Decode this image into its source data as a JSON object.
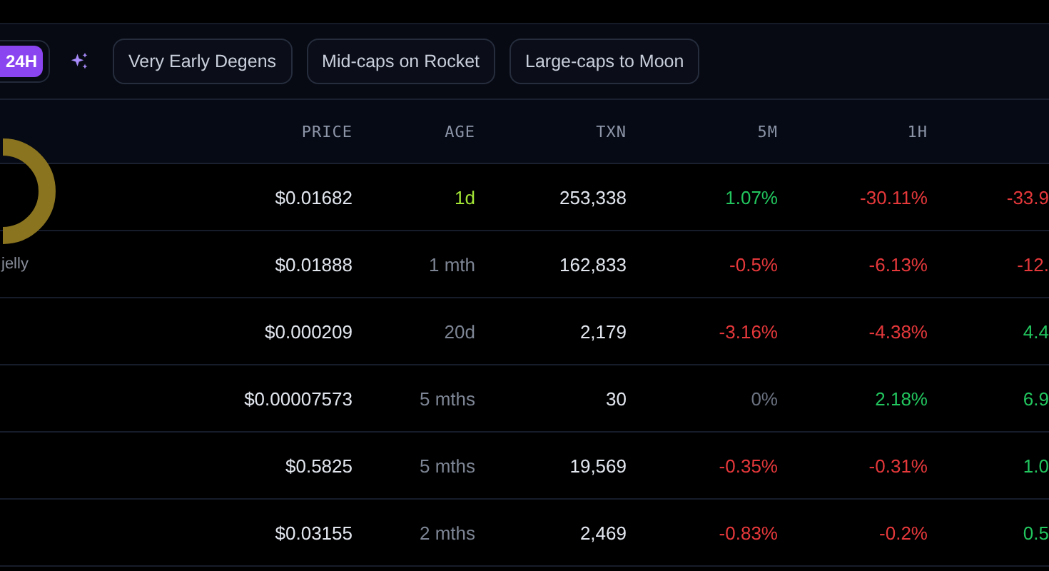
{
  "toolbar": {
    "timeframes": [
      {
        "label": "24H",
        "selected": true
      }
    ],
    "presets": [
      {
        "label": "Very Early Degens"
      },
      {
        "label": "Mid-caps on Rocket"
      },
      {
        "label": "Large-caps to Moon"
      }
    ]
  },
  "table": {
    "columns": [
      "PRICE",
      "AGE",
      "TXN",
      "5M",
      "1H"
    ],
    "rows": [
      {
        "token": "",
        "price": "$0.01682",
        "age": "1d",
        "age_new": true,
        "txn": "253,338",
        "m5": "1.07%",
        "h1": "-30.11%",
        "column_7": "-33.9"
      },
      {
        "token": "jelly",
        "price": "$0.01888",
        "age": "1 mth",
        "age_new": false,
        "txn": "162,833",
        "m5": "-0.5%",
        "h1": "-6.13%",
        "column_7": "-12."
      },
      {
        "token": "",
        "price": "$0.000209",
        "age": "20d",
        "age_new": false,
        "txn": "2,179",
        "m5": "-3.16%",
        "h1": "-4.38%",
        "column_7": "4.4"
      },
      {
        "token": "",
        "price": "$0.00007573",
        "age": "5 mths",
        "age_new": false,
        "txn": "30",
        "m5": "0%",
        "h1": "2.18%",
        "column_7": "6.9"
      },
      {
        "token": "",
        "price": "$0.5825",
        "age": "5 mths",
        "age_new": false,
        "txn": "19,569",
        "m5": "-0.35%",
        "h1": "-0.31%",
        "column_7": "1.0"
      },
      {
        "token": "",
        "price": "$0.03155",
        "age": "2 mths",
        "age_new": false,
        "txn": "2,469",
        "m5": "-0.83%",
        "h1": "-0.2%",
        "column_7": "0.5"
      }
    ]
  }
}
